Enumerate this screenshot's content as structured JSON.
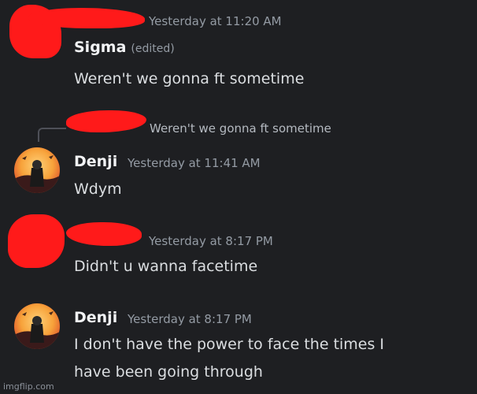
{
  "messages": [
    {
      "username": "",
      "timestamp": "Yesterday at 11:20 AM",
      "edited_label": "(edited)",
      "display_name": "Sigma",
      "text": "Weren't we gonna ft sometime"
    },
    {
      "reply_preview": "Weren't we gonna ft sometime",
      "username": "Denji",
      "timestamp": "Yesterday at 11:41 AM",
      "text": "Wdym"
    },
    {
      "timestamp": "Yesterday at 8:17 PM",
      "text": "Didn't u wanna facetime"
    },
    {
      "username": "Denji",
      "timestamp": "Yesterday at 8:17 PM",
      "text_line1": "I don't have the power to face the times I",
      "text_line2": "have been going through"
    }
  ],
  "watermark": "imgflip.com",
  "colors": {
    "background": "#1e1f22",
    "redaction": "#ff1a1a"
  }
}
